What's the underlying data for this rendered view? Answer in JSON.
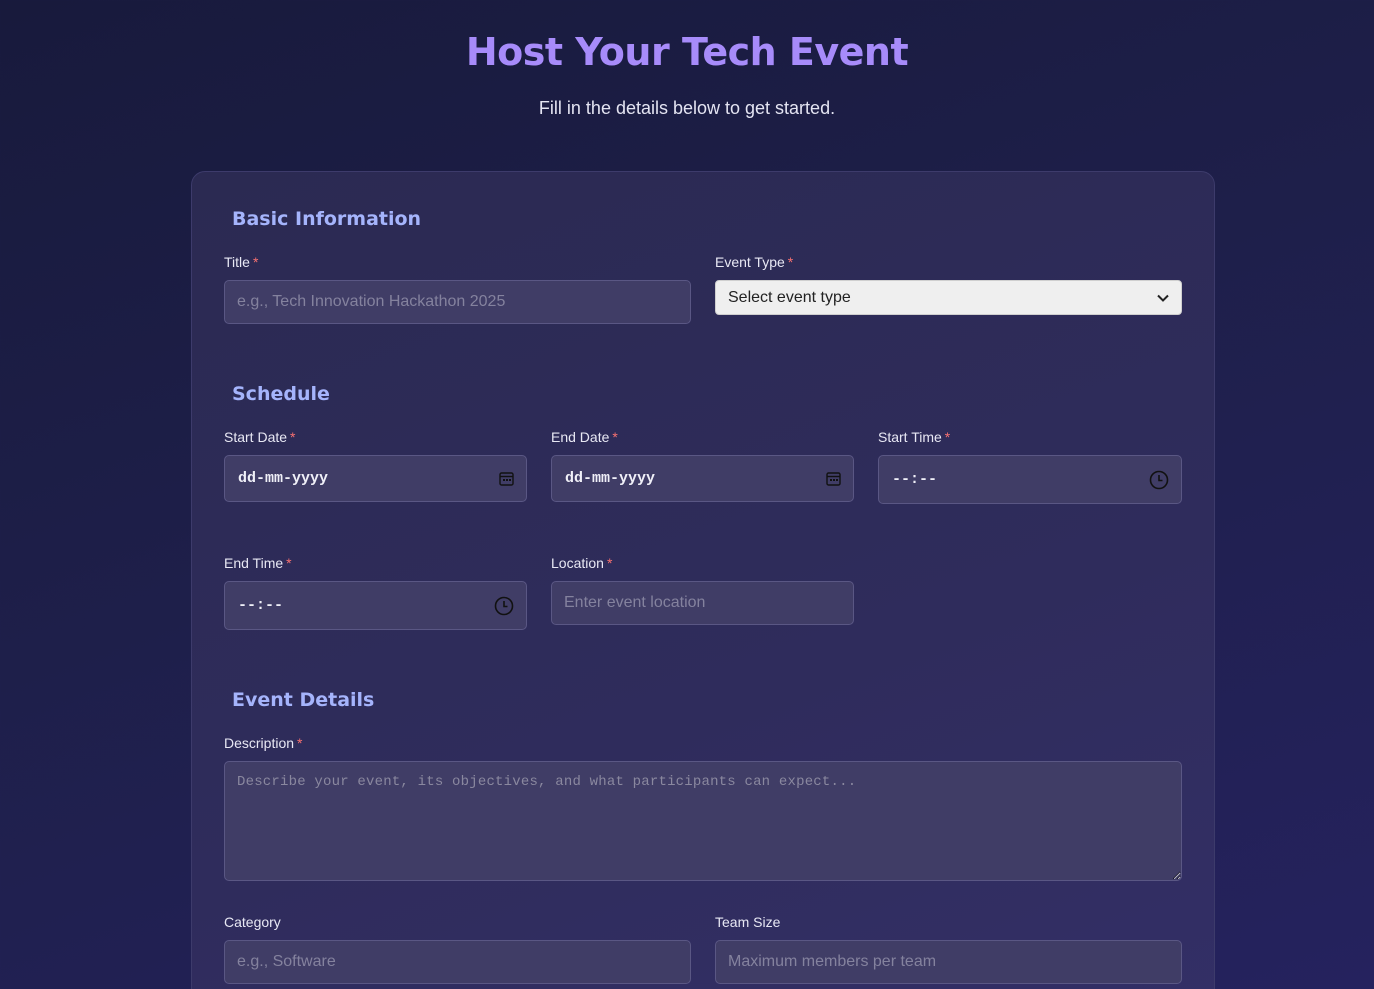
{
  "header": {
    "title": "Host Your Tech Event",
    "subtitle": "Fill in the details below to get started."
  },
  "sections": {
    "basic": "Basic Information",
    "schedule": "Schedule",
    "details": "Event Details"
  },
  "required_marker": "*",
  "fields": {
    "title": {
      "label": "Title",
      "placeholder": "e.g., Tech Innovation Hackathon 2025"
    },
    "event_type": {
      "label": "Event Type",
      "value": "Select event type"
    },
    "start_date": {
      "label": "Start Date",
      "value": "dd-mm-yyyy"
    },
    "end_date": {
      "label": "End Date",
      "value": "dd-mm-yyyy"
    },
    "start_time": {
      "label": "Start Time",
      "value": "--:--"
    },
    "end_time": {
      "label": "End Time",
      "value": "--:--"
    },
    "location": {
      "label": "Location",
      "placeholder": "Enter event location"
    },
    "description": {
      "label": "Description",
      "placeholder": "Describe your event, its objectives, and what participants can expect..."
    },
    "category": {
      "label": "Category",
      "placeholder": "e.g., Software"
    },
    "team_size": {
      "label": "Team Size",
      "placeholder": "Maximum members per team"
    }
  },
  "icons": {
    "date": "calendar-icon",
    "time": "clock-icon",
    "select": "chevron-down-icon"
  }
}
